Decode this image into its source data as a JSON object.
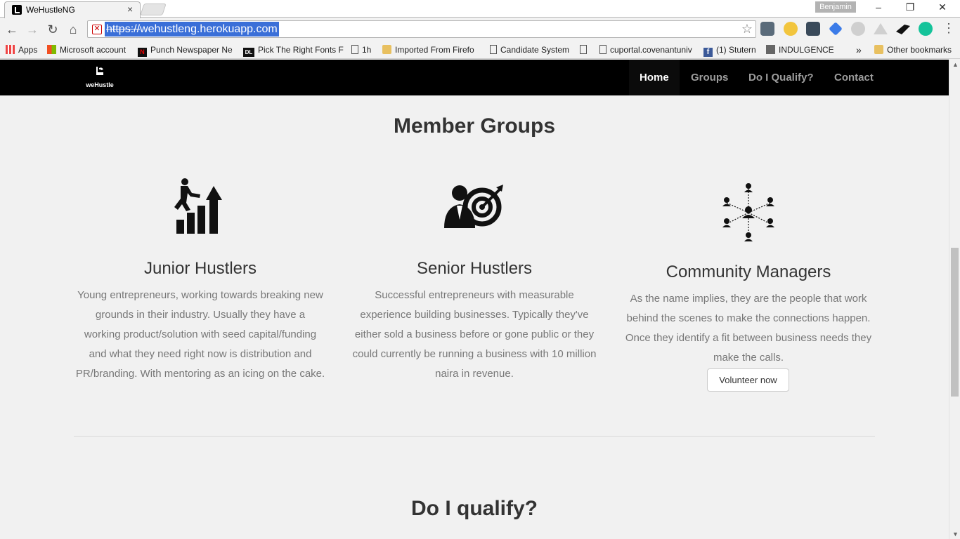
{
  "browser": {
    "tab_title": "WeHustleNG",
    "tab_close": "×",
    "profile_name": "Benjamin",
    "window_controls": {
      "minimize": "–",
      "restore": "❐",
      "close": "✕"
    },
    "nav": {
      "back": "←",
      "forward": "→",
      "reload": "↻",
      "home": "⌂"
    },
    "url_protocol": "https://",
    "url_rest": "wehustleng.herokuapp.com",
    "star": "☆",
    "menu": "⋮",
    "bookmarks": [
      {
        "label": "Apps",
        "icon": "apps-grid-icon"
      },
      {
        "label": "Microsoft account",
        "icon": "microsoft-icon"
      },
      {
        "label": "Punch Newspaper Ne",
        "icon": "punch-icon"
      },
      {
        "label": "Pick The Right Fonts F",
        "icon": "dl-icon"
      },
      {
        "label": "1h",
        "icon": "page-icon"
      },
      {
        "label": "Imported From Firefo",
        "icon": "folder-icon"
      },
      {
        "label": "Candidate System",
        "icon": "page-icon"
      },
      {
        "label": "",
        "icon": "page-icon"
      },
      {
        "label": "cuportal.covenantuniv",
        "icon": "page-icon"
      },
      {
        "label": "(1) Stutern",
        "icon": "facebook-icon"
      },
      {
        "label": "INDULGENCE",
        "icon": "indulgence-icon"
      }
    ],
    "bookmarks_more": "»",
    "other_bookmarks": "Other bookmarks"
  },
  "site": {
    "logo_text": "weHustle",
    "nav": {
      "home": "Home",
      "groups": "Groups",
      "qualify": "Do I Qualify?",
      "contact": "Contact"
    },
    "member_groups_title": "Member Groups",
    "groups": [
      {
        "name": "Junior Hustlers",
        "icon": "growth-chart-icon",
        "lines": [
          "Young entrepreneurs, working towards breaking new",
          "grounds in their industry. Usually they have a",
          "working product/solution with seed capital/funding",
          "and what they need right now is distribution and",
          "PR/branding. With mentoring as an icing on the cake."
        ]
      },
      {
        "name": "Senior Hustlers",
        "icon": "target-businessman-icon",
        "lines": [
          "Successful entrepreneurs with measurable",
          "experience building businesses. Typically they've",
          "either sold a business before or gone public or they",
          "could currently be running a business with 10 million",
          "naira in revenue."
        ]
      },
      {
        "name": "Community Managers",
        "icon": "network-people-icon",
        "lines": [
          "As the name implies, they are the people that work",
          "behind the scenes to make the connections happen.",
          "Once they identify a fit between business needs they",
          "make the calls."
        ],
        "button": "Volunteer now"
      }
    ],
    "qualify_title": "Do I qualify?"
  },
  "colors": {
    "nav_bg": "#000000",
    "page_bg": "#f1f1f1",
    "heading": "#333333",
    "body_text": "#777777",
    "url_highlight": "#3a6fd8"
  }
}
